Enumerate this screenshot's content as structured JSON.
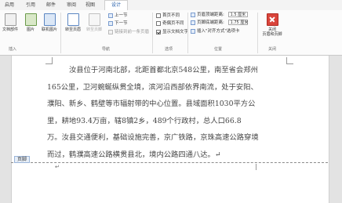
{
  "tabs": [
    "启用",
    "引用",
    "邮件",
    "审阅",
    "视图",
    "设计"
  ],
  "active_tab": "设计",
  "groups": {
    "insert": {
      "label": "插入",
      "buttons": [
        "文档部件",
        "图片",
        "联机图片"
      ]
    },
    "navigation": {
      "label": "导航",
      "goto_header": "转至页眉",
      "goto_footer": "转至页脚",
      "prev": "上一节",
      "next": "下一节",
      "link_prev": "链接到前一条页眉"
    },
    "options": {
      "label": "选项",
      "items": [
        {
          "label": "首页不同",
          "checked": false
        },
        {
          "label": "奇偶页不同",
          "checked": false
        },
        {
          "label": "显示文档文字",
          "checked": true
        }
      ]
    },
    "position": {
      "label": "位置",
      "header_top_label": "页眉顶端距离:",
      "header_top_value": "1.5 厘米",
      "footer_bottom_label": "页脚底端距离:",
      "footer_bottom_value": "1.75 厘米",
      "insert_align_tab": "插入\"对齐方式\"选项卡"
    },
    "close": {
      "label": "关闭",
      "button": "关闭\n页眉和页脚"
    }
  },
  "document": {
    "lines": [
      "汝县位于河南北部，北距首都北京548公里，南至省会郑州",
      "165公里，卫河蜿蜒纵贯全境，滨河沿西部依界南流，处于安阳、",
      "濮阳、新乡、鹤壁等市辐射带的中心位置。县域面积1030平方公",
      "里，耕地93.4万亩，辖8镇2乡，489个行政村，总人口66.8",
      "万。汝县交通便利，基础设施完善，京广铁路，京珠高速公路穿境",
      "而过，鹤濮高速公路横贯县北，境内公路四通八达。↵"
    ],
    "footer_label": "页脚",
    "footer_mark": "↵"
  },
  "colors": {
    "accent": "#1e5aa8",
    "close_icon": "#d9443b",
    "page_bg": "#ffffff"
  }
}
